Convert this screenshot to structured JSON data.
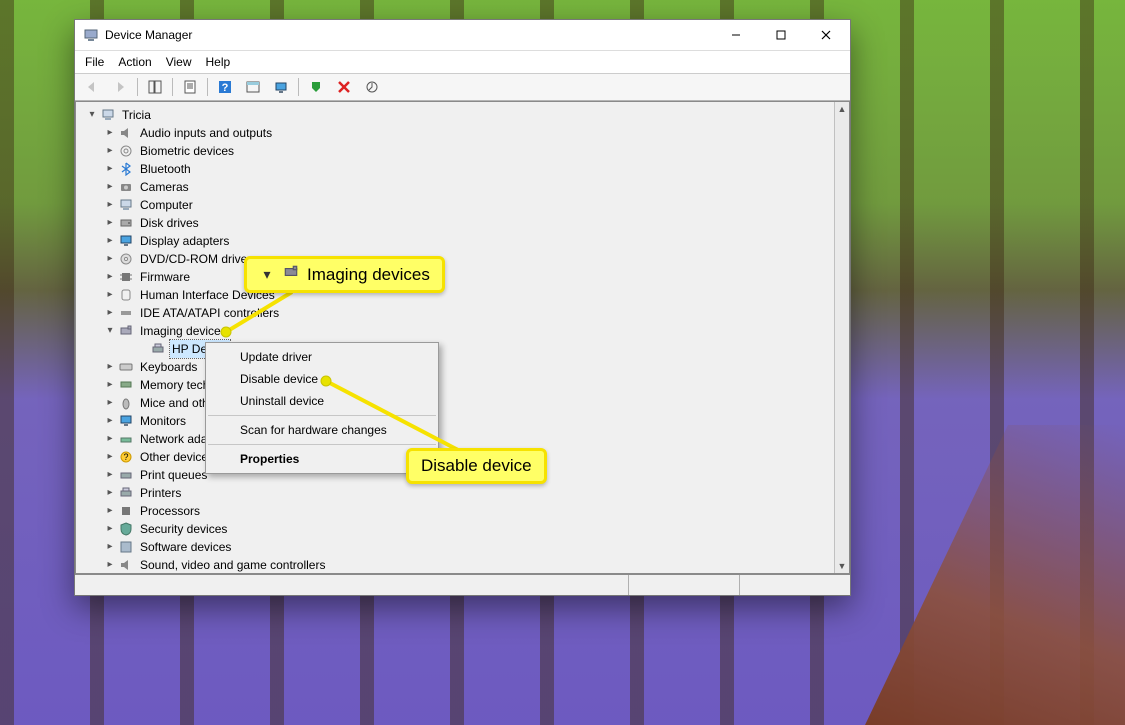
{
  "window": {
    "title": "Device Manager"
  },
  "menu": {
    "file": "File",
    "action": "Action",
    "view": "View",
    "help": "Help"
  },
  "tree": {
    "root": "Tricia",
    "items": [
      "Audio inputs and outputs",
      "Biometric devices",
      "Bluetooth",
      "Cameras",
      "Computer",
      "Disk drives",
      "Display adapters",
      "DVD/CD-ROM drive",
      "Firmware",
      "Human Interface Devices",
      "IDE ATA/ATAPI controllers",
      "Imaging devices",
      "Keyboards",
      "Memory tech",
      "Mice and oth",
      "Monitors",
      "Network adap",
      "Other devices",
      "Print queues",
      "Printers",
      "Processors",
      "Security devices",
      "Software devices",
      "Sound, video and game controllers"
    ],
    "imaging_child": "HP Deskje"
  },
  "context_menu": {
    "update": "Update driver",
    "disable": "Disable device",
    "uninstall": "Uninstall device",
    "scan": "Scan for hardware changes",
    "properties": "Properties"
  },
  "callouts": {
    "imaging": "Imaging devices",
    "disable": "Disable device"
  }
}
